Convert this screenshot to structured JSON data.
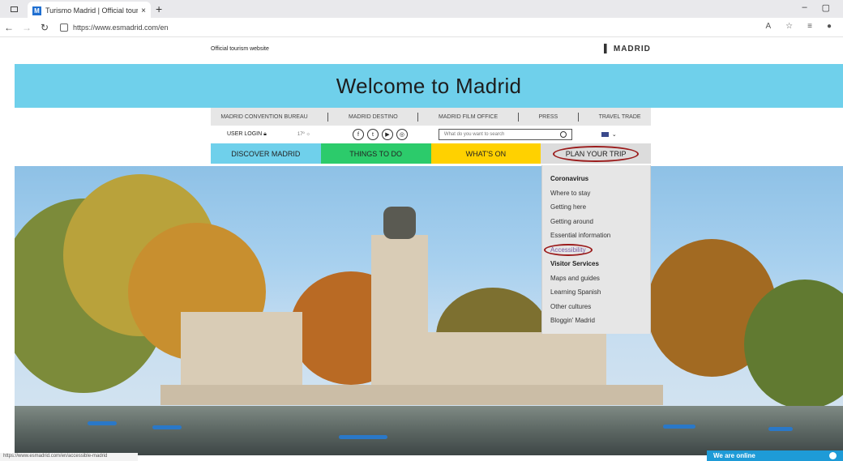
{
  "browser": {
    "tab_title": "Turismo Madrid | Official tourism",
    "tab_favicon": "M",
    "url": "https://www.esmadrid.com/en",
    "icons": [
      "tab-actions-icon",
      "close-icon",
      "new-tab-icon",
      "back-icon",
      "forward-icon",
      "refresh-icon",
      "lock-icon",
      "read-aloud-icon",
      "favorites-icon",
      "collections-icon",
      "profile-icon",
      "minimize-icon",
      "maximize-icon"
    ]
  },
  "page": {
    "official_label": "Official tourism website",
    "logo_text": "MADRID",
    "banner_title": "Welcome to Madrid",
    "util_links": [
      "MADRID CONVENTION BUREAU",
      "MADRID DESTINO",
      "MADRID FILM OFFICE",
      "PRESS",
      "TRAVEL TRADE"
    ],
    "user_login": "USER LOGIN",
    "temperature": "17º",
    "social_icons": [
      "facebook-icon",
      "twitter-icon",
      "youtube-icon",
      "instagram-icon"
    ],
    "search_placeholder": "What do you want to search",
    "main_nav": [
      "DISCOVER MADRID",
      "THINGS TO DO",
      "WHAT'S ON",
      "PLAN YOUR TRIP"
    ],
    "colors": {
      "banner": "#6fd0eb",
      "discover": "#6fd0eb",
      "things": "#2ccb6b",
      "whatson": "#ffd100",
      "plan": "#dcdcdc",
      "highlight_ring": "#9b1c1c",
      "online_badge": "#1e9bd7"
    },
    "dropdown": [
      {
        "label": "Coronavirus",
        "type": "head"
      },
      {
        "label": "Where to stay",
        "type": "item"
      },
      {
        "label": "Getting here",
        "type": "item"
      },
      {
        "label": "Getting around",
        "type": "item"
      },
      {
        "label": "Essential information",
        "type": "item"
      },
      {
        "label": "Accessibility",
        "type": "highlight"
      },
      {
        "label": "Visitor Services",
        "type": "head"
      },
      {
        "label": "Maps and guides",
        "type": "item"
      },
      {
        "label": "Learning Spanish",
        "type": "item"
      },
      {
        "label": "Other cultures",
        "type": "item"
      },
      {
        "label": "Bloggin' Madrid",
        "type": "item"
      }
    ],
    "status_url": "https://www.esmadrid.com/en/accessible-madrid",
    "online_label": "We are online"
  }
}
